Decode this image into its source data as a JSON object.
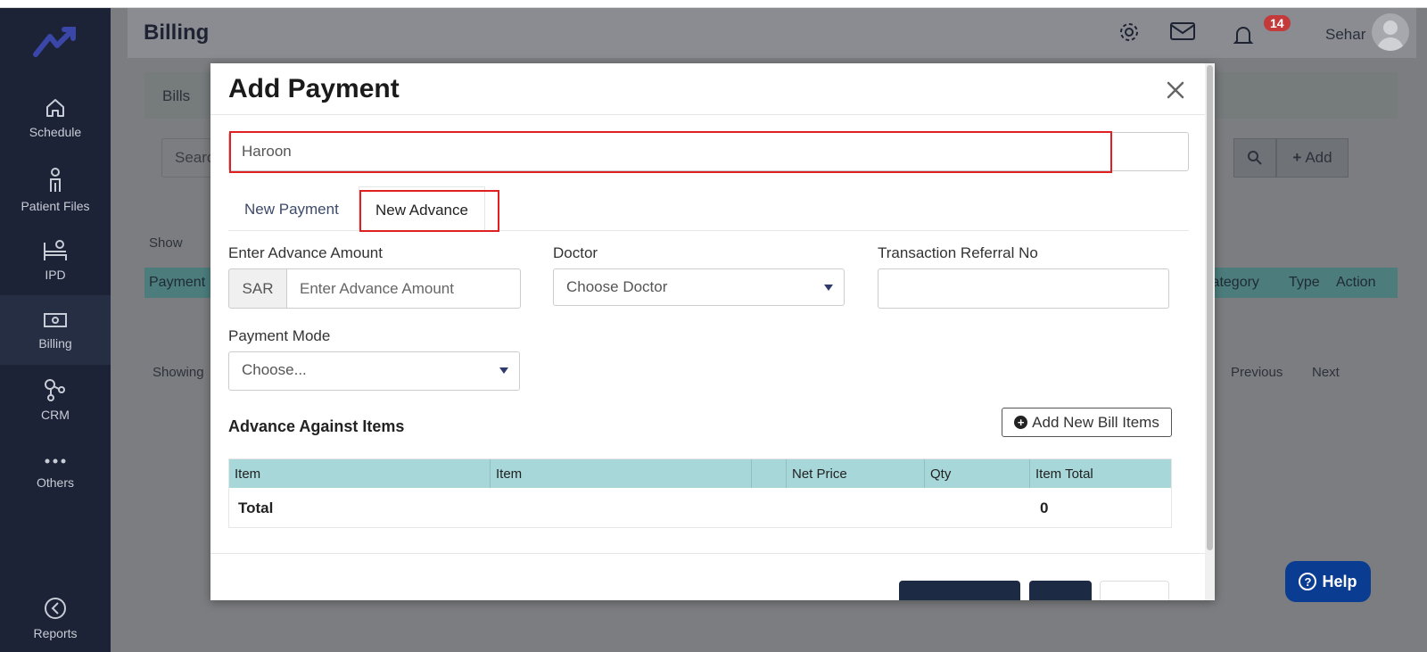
{
  "sidebar": {
    "items": [
      {
        "label": "Schedule",
        "icon": "home-icon"
      },
      {
        "label": "Patient Files",
        "icon": "person-icon"
      },
      {
        "label": "IPD",
        "icon": "bed-icon"
      },
      {
        "label": "Billing",
        "icon": "money-icon"
      },
      {
        "label": "CRM",
        "icon": "network-icon"
      },
      {
        "label": "Others",
        "icon": "dots-icon"
      },
      {
        "label": "Reports",
        "icon": "chart-icon"
      }
    ]
  },
  "header": {
    "title": "Billing",
    "notification_count": "14",
    "user_name": "Sehar"
  },
  "background": {
    "tab_label": "Bills",
    "search_placeholder": "Searc",
    "add_label": "Add",
    "show_label": "Show",
    "showing_label": "Showing",
    "previous_label": "Previous",
    "next_label": "Next",
    "columns": [
      "Payment",
      "Category",
      "Type",
      "Action"
    ]
  },
  "help": {
    "label": "Help"
  },
  "modal": {
    "title": "Add Payment",
    "patient_value": "Haroon",
    "tabs": [
      "New Payment",
      "New Advance"
    ],
    "active_tab": "New Advance",
    "form": {
      "amount_label": "Enter Advance Amount",
      "currency": "SAR",
      "amount_placeholder": "Enter Advance Amount",
      "doctor_label": "Doctor",
      "doctor_value": "Choose Doctor",
      "referral_label": "Transaction Referral No",
      "referral_value": "",
      "mode_label": "Payment Mode",
      "mode_value": "Choose..."
    },
    "items_section": {
      "title": "Advance Against Items",
      "add_button": "Add New Bill Items",
      "columns": [
        "Item",
        "Item",
        "",
        "Net Price",
        "Qty",
        "Item Total"
      ],
      "total_label": "Total",
      "total_value": "0"
    }
  },
  "colors": {
    "sidebar_bg": "#1c2336",
    "accent": "#3a46a8",
    "table_header": "#a7d7d9",
    "highlight": "#e02020",
    "help_bg": "#0a3d91"
  }
}
